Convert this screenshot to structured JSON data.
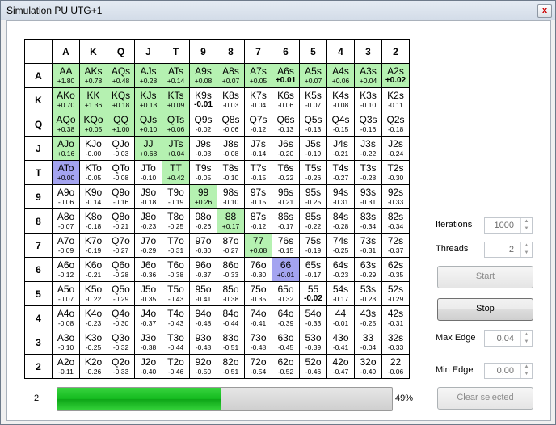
{
  "window": {
    "title": "Simulation PU UTG+1",
    "close_glyph": "x"
  },
  "ranks": [
    "A",
    "K",
    "Q",
    "J",
    "T",
    "9",
    "8",
    "7",
    "6",
    "5",
    "4",
    "3",
    "2"
  ],
  "grid": [
    [
      [
        "AA",
        "+1.80",
        "g",
        0
      ],
      [
        "AKs",
        "+0.78",
        "g",
        0
      ],
      [
        "AQs",
        "+0.48",
        "g",
        0
      ],
      [
        "AJs",
        "+0.28",
        "g",
        0
      ],
      [
        "ATs",
        "+0.14",
        "g",
        0
      ],
      [
        "A9s",
        "+0.08",
        "g",
        0
      ],
      [
        "A8s",
        "+0.07",
        "g",
        0
      ],
      [
        "A7s",
        "+0.05",
        "g",
        0
      ],
      [
        "A6s",
        "+0.01",
        "g",
        1
      ],
      [
        "A5s",
        "+0.07",
        "g",
        0
      ],
      [
        "A4s",
        "+0.06",
        "g",
        0
      ],
      [
        "A3s",
        "+0.04",
        "g",
        0
      ],
      [
        "A2s",
        "+0.02",
        "g",
        1
      ]
    ],
    [
      [
        "AKo",
        "+0.70",
        "g",
        0
      ],
      [
        "KK",
        "+1.36",
        "g",
        0
      ],
      [
        "KQs",
        "+0.18",
        "g",
        0
      ],
      [
        "KJs",
        "+0.13",
        "g",
        0
      ],
      [
        "KTs",
        "+0.09",
        "g",
        0
      ],
      [
        "K9s",
        "-0.01",
        "",
        1
      ],
      [
        "K8s",
        "-0.03",
        "",
        0
      ],
      [
        "K7s",
        "-0.04",
        "",
        0
      ],
      [
        "K6s",
        "-0.06",
        "",
        0
      ],
      [
        "K5s",
        "-0.07",
        "",
        0
      ],
      [
        "K4s",
        "-0.08",
        "",
        0
      ],
      [
        "K3s",
        "-0.10",
        "",
        0
      ],
      [
        "K2s",
        "-0.11",
        "",
        0
      ]
    ],
    [
      [
        "AQo",
        "+0.38",
        "g",
        0
      ],
      [
        "KQo",
        "+0.05",
        "g",
        0
      ],
      [
        "QQ",
        "+1.00",
        "g",
        0
      ],
      [
        "QJs",
        "+0.10",
        "g",
        0
      ],
      [
        "QTs",
        "+0.06",
        "g",
        0
      ],
      [
        "Q9s",
        "-0.02",
        "",
        0
      ],
      [
        "Q8s",
        "-0.06",
        "",
        0
      ],
      [
        "Q7s",
        "-0.12",
        "",
        0
      ],
      [
        "Q6s",
        "-0.13",
        "",
        0
      ],
      [
        "Q5s",
        "-0.13",
        "",
        0
      ],
      [
        "Q4s",
        "-0.15",
        "",
        0
      ],
      [
        "Q3s",
        "-0.16",
        "",
        0
      ],
      [
        "Q2s",
        "-0.18",
        "",
        0
      ]
    ],
    [
      [
        "AJo",
        "+0.16",
        "g",
        0
      ],
      [
        "KJo",
        "-0.00",
        "",
        0
      ],
      [
        "QJo",
        "-0.03",
        "",
        0
      ],
      [
        "JJ",
        "+0.68",
        "g",
        0
      ],
      [
        "JTs",
        "+0.04",
        "g",
        0
      ],
      [
        "J9s",
        "-0.03",
        "",
        0
      ],
      [
        "J8s",
        "-0.08",
        "",
        0
      ],
      [
        "J7s",
        "-0.14",
        "",
        0
      ],
      [
        "J6s",
        "-0.20",
        "",
        0
      ],
      [
        "J5s",
        "-0.19",
        "",
        0
      ],
      [
        "J4s",
        "-0.21",
        "",
        0
      ],
      [
        "J3s",
        "-0.22",
        "",
        0
      ],
      [
        "J2s",
        "-0.24",
        "",
        0
      ]
    ],
    [
      [
        "ATo",
        "+0.00",
        "b",
        0
      ],
      [
        "KTo",
        "-0.05",
        "",
        0
      ],
      [
        "QTo",
        "-0.08",
        "",
        0
      ],
      [
        "JTo",
        "-0.10",
        "",
        0
      ],
      [
        "TT",
        "+0.42",
        "g",
        0
      ],
      [
        "T9s",
        "-0.05",
        "",
        0
      ],
      [
        "T8s",
        "-0.10",
        "",
        0
      ],
      [
        "T7s",
        "-0.15",
        "",
        0
      ],
      [
        "T6s",
        "-0.22",
        "",
        0
      ],
      [
        "T5s",
        "-0.26",
        "",
        0
      ],
      [
        "T4s",
        "-0.27",
        "",
        0
      ],
      [
        "T3s",
        "-0.28",
        "",
        0
      ],
      [
        "T2s",
        "-0.30",
        "",
        0
      ]
    ],
    [
      [
        "A9o",
        "-0.06",
        "",
        0
      ],
      [
        "K9o",
        "-0.14",
        "",
        0
      ],
      [
        "Q9o",
        "-0.16",
        "",
        0
      ],
      [
        "J9o",
        "-0.18",
        "",
        0
      ],
      [
        "T9o",
        "-0.19",
        "",
        0
      ],
      [
        "99",
        "+0.26",
        "g",
        0
      ],
      [
        "98s",
        "-0.10",
        "",
        0
      ],
      [
        "97s",
        "-0.15",
        "",
        0
      ],
      [
        "96s",
        "-0.21",
        "",
        0
      ],
      [
        "95s",
        "-0.25",
        "",
        0
      ],
      [
        "94s",
        "-0.31",
        "",
        0
      ],
      [
        "93s",
        "-0.31",
        "",
        0
      ],
      [
        "92s",
        "-0.33",
        "",
        0
      ]
    ],
    [
      [
        "A8o",
        "-0.07",
        "",
        0
      ],
      [
        "K8o",
        "-0.18",
        "",
        0
      ],
      [
        "Q8o",
        "-0.21",
        "",
        0
      ],
      [
        "J8o",
        "-0.23",
        "",
        0
      ],
      [
        "T8o",
        "-0.25",
        "",
        0
      ],
      [
        "98o",
        "-0.26",
        "",
        0
      ],
      [
        "88",
        "+0.17",
        "g",
        0
      ],
      [
        "87s",
        "-0.12",
        "",
        0
      ],
      [
        "86s",
        "-0.17",
        "",
        0
      ],
      [
        "85s",
        "-0.22",
        "",
        0
      ],
      [
        "84s",
        "-0.28",
        "",
        0
      ],
      [
        "83s",
        "-0.34",
        "",
        0
      ],
      [
        "82s",
        "-0.34",
        "",
        0
      ]
    ],
    [
      [
        "A7o",
        "-0.09",
        "",
        0
      ],
      [
        "K7o",
        "-0.19",
        "",
        0
      ],
      [
        "Q7o",
        "-0.27",
        "",
        0
      ],
      [
        "J7o",
        "-0.29",
        "",
        0
      ],
      [
        "T7o",
        "-0.31",
        "",
        0
      ],
      [
        "97o",
        "-0.30",
        "",
        0
      ],
      [
        "87o",
        "-0.27",
        "",
        0
      ],
      [
        "77",
        "+0.08",
        "g",
        0
      ],
      [
        "76s",
        "-0.15",
        "",
        0
      ],
      [
        "75s",
        "-0.19",
        "",
        0
      ],
      [
        "74s",
        "-0.25",
        "",
        0
      ],
      [
        "73s",
        "-0.31",
        "",
        0
      ],
      [
        "72s",
        "-0.37",
        "",
        0
      ]
    ],
    [
      [
        "A6o",
        "-0.12",
        "",
        0
      ],
      [
        "K6o",
        "-0.21",
        "",
        0
      ],
      [
        "Q6o",
        "-0.28",
        "",
        0
      ],
      [
        "J6o",
        "-0.36",
        "",
        0
      ],
      [
        "T6o",
        "-0.38",
        "",
        0
      ],
      [
        "96o",
        "-0.37",
        "",
        0
      ],
      [
        "86o",
        "-0.33",
        "",
        0
      ],
      [
        "76o",
        "-0.30",
        "",
        0
      ],
      [
        "66",
        "+0.01",
        "b",
        0
      ],
      [
        "65s",
        "-0.17",
        "",
        0
      ],
      [
        "64s",
        "-0.23",
        "",
        0
      ],
      [
        "63s",
        "-0.29",
        "",
        0
      ],
      [
        "62s",
        "-0.35",
        "",
        0
      ]
    ],
    [
      [
        "A5o",
        "-0.07",
        "",
        0
      ],
      [
        "K5o",
        "-0.22",
        "",
        0
      ],
      [
        "Q5o",
        "-0.29",
        "",
        0
      ],
      [
        "J5o",
        "-0.35",
        "",
        0
      ],
      [
        "T5o",
        "-0.43",
        "",
        0
      ],
      [
        "95o",
        "-0.41",
        "",
        0
      ],
      [
        "85o",
        "-0.38",
        "",
        0
      ],
      [
        "75o",
        "-0.35",
        "",
        0
      ],
      [
        "65o",
        "-0.32",
        "",
        0
      ],
      [
        "55",
        "-0.02",
        "",
        1
      ],
      [
        "54s",
        "-0.17",
        "",
        0
      ],
      [
        "53s",
        "-0.23",
        "",
        0
      ],
      [
        "52s",
        "-0.29",
        "",
        0
      ]
    ],
    [
      [
        "A4o",
        "-0.08",
        "",
        0
      ],
      [
        "K4o",
        "-0.23",
        "",
        0
      ],
      [
        "Q4o",
        "-0.30",
        "",
        0
      ],
      [
        "J4o",
        "-0.37",
        "",
        0
      ],
      [
        "T4o",
        "-0.43",
        "",
        0
      ],
      [
        "94o",
        "-0.48",
        "",
        0
      ],
      [
        "84o",
        "-0.44",
        "",
        0
      ],
      [
        "74o",
        "-0.41",
        "",
        0
      ],
      [
        "64o",
        "-0.39",
        "",
        0
      ],
      [
        "54o",
        "-0.33",
        "",
        0
      ],
      [
        "44",
        "-0.01",
        "",
        0
      ],
      [
        "43s",
        "-0.25",
        "",
        0
      ],
      [
        "42s",
        "-0.31",
        "",
        0
      ]
    ],
    [
      [
        "A3o",
        "-0.10",
        "",
        0
      ],
      [
        "K3o",
        "-0.25",
        "",
        0
      ],
      [
        "Q3o",
        "-0.32",
        "",
        0
      ],
      [
        "J3o",
        "-0.38",
        "",
        0
      ],
      [
        "T3o",
        "-0.44",
        "",
        0
      ],
      [
        "93o",
        "-0.48",
        "",
        0
      ],
      [
        "83o",
        "-0.51",
        "",
        0
      ],
      [
        "73o",
        "-0.48",
        "",
        0
      ],
      [
        "63o",
        "-0.45",
        "",
        0
      ],
      [
        "53o",
        "-0.39",
        "",
        0
      ],
      [
        "43o",
        "-0.41",
        "",
        0
      ],
      [
        "33",
        "-0.04",
        "",
        0
      ],
      [
        "32s",
        "-0.33",
        "",
        0
      ]
    ],
    [
      [
        "A2o",
        "-0.11",
        "",
        0
      ],
      [
        "K2o",
        "-0.26",
        "",
        0
      ],
      [
        "Q2o",
        "-0.33",
        "",
        0
      ],
      [
        "J2o",
        "-0.40",
        "",
        0
      ],
      [
        "T2o",
        "-0.46",
        "",
        0
      ],
      [
        "92o",
        "-0.50",
        "",
        0
      ],
      [
        "82o",
        "-0.51",
        "",
        0
      ],
      [
        "72o",
        "-0.54",
        "",
        0
      ],
      [
        "62o",
        "-0.52",
        "",
        0
      ],
      [
        "52o",
        "-0.46",
        "",
        0
      ],
      [
        "42o",
        "-0.47",
        "",
        0
      ],
      [
        "32o",
        "-0.49",
        "",
        0
      ],
      [
        "22",
        "-0.06",
        "",
        0
      ]
    ]
  ],
  "colors": {
    "green": "#b5f1b1",
    "blue": "#a4a4f0",
    "progress": "#13b91e"
  },
  "controls": {
    "iterations_label": "Iterations",
    "iterations_value": "1000",
    "threads_label": "Threads",
    "threads_value": "2",
    "start_label": "Start",
    "stop_label": "Stop",
    "max_edge_label": "Max Edge",
    "max_edge_value": "0,04",
    "min_edge_label": "Min Edge",
    "min_edge_value": "0,00",
    "clear_label": "Clear selected"
  },
  "status": {
    "threads_running": "2",
    "progress_pct": 49,
    "progress_text": "49%"
  }
}
